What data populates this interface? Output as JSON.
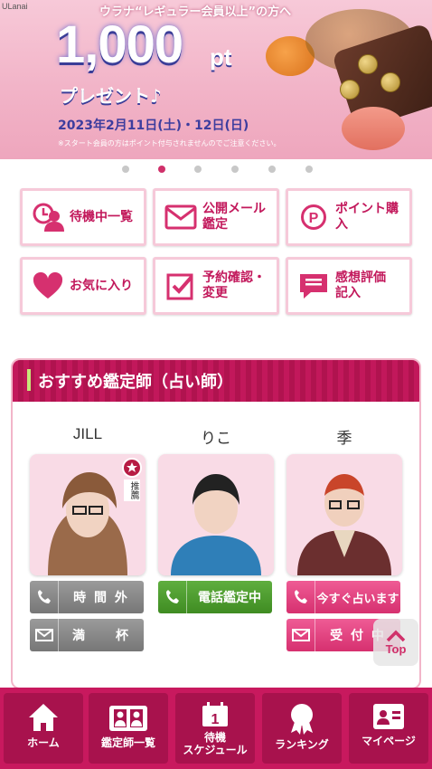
{
  "banner": {
    "corner_text": "ULanai",
    "headline": "ウラナ“レギュラー会員以上”の方へ",
    "points": "1,000",
    "points_unit": "pt",
    "present": "プレゼント♪",
    "date": "2023年2月11日(土)・12日(日)",
    "note": "※スタート会員の方はポイント付与されませんのでご注意ください。"
  },
  "carousel": {
    "slides": 7,
    "active_index": 1
  },
  "menu": {
    "waiting_list": "待機中一覧",
    "public_mail_line1": "公開メール",
    "public_mail_line2": "鑑定",
    "buy_points": "ポイント購入",
    "favorites": "お気に入り",
    "reservation_line1": "予約確認・",
    "reservation_line2": "変更",
    "review_line1": "感想評価",
    "review_line2": "記入"
  },
  "recommend": {
    "title": "おすすめ鑑定師（占い師）",
    "fortune_tellers": [
      {
        "name": "JILL",
        "badge": "推薦",
        "status": "時 間 外",
        "mail": "満　　杯"
      },
      {
        "name": "りこ",
        "status": "電話鑑定中"
      },
      {
        "name": "季",
        "status": "今すぐ占います",
        "mail": "受 付 中"
      }
    ]
  },
  "top_button": "Top",
  "nav": {
    "home": "ホーム",
    "list": "鑑定師一覧",
    "schedule_line1": "待機",
    "schedule_line2": "スケジュール",
    "ranking": "ランキング",
    "mypage": "マイページ"
  },
  "colors": {
    "brand": "#c8195e",
    "accent_pink": "#d6306f",
    "call_green": "#3f8c22",
    "offline_gray": "#777777"
  }
}
